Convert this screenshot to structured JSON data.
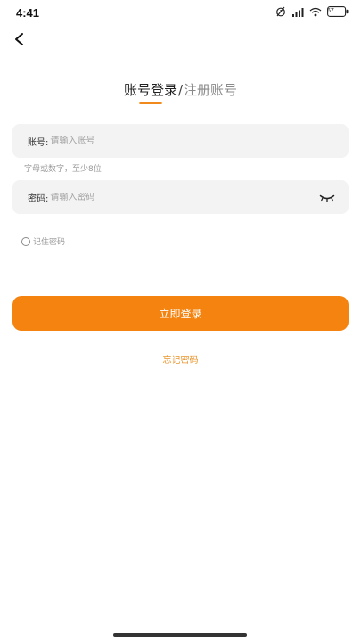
{
  "status_bar": {
    "time": "4:41",
    "icons": [
      "alarm-icon",
      "signal-icon",
      "wifi-icon",
      "battery-icon"
    ],
    "battery_level_text": "67"
  },
  "nav": {
    "back_icon": "chevron-left-icon"
  },
  "tabs": {
    "login_label": "账号登录",
    "separator": "/",
    "register_label": "注册账号"
  },
  "account_field": {
    "label": "账号:",
    "placeholder": "请输入账号",
    "hint": "字母或数字，至少8位"
  },
  "password_field": {
    "label": "密码:",
    "placeholder": "请输入密码",
    "toggle_icon": "eye-closed-icon"
  },
  "remember": {
    "label": "记住密码",
    "checked": false
  },
  "login_button": {
    "label": "立即登录"
  },
  "forgot_link": {
    "label": "忘记密码"
  },
  "colors": {
    "accent": "#f5830f",
    "link": "#e8962f",
    "field_bg": "#f3f3f3"
  }
}
